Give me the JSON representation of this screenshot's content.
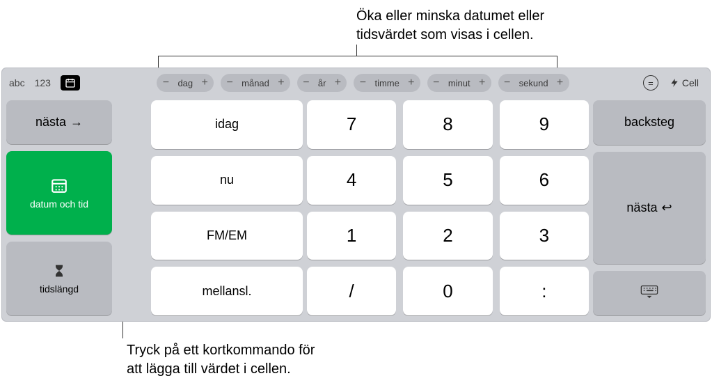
{
  "annotations": {
    "top": "Öka eller minska datumet eller\ntidsvärdet som visas i cellen.",
    "bottom": "Tryck på ett kortkommando för\natt lägga till värdet i cellen."
  },
  "topbar": {
    "tabs": {
      "abc": "abc",
      "num": "123"
    },
    "increments": {
      "day": "dag",
      "month": "månad",
      "year": "år",
      "hour": "timme",
      "minute": "minut",
      "second": "sekund"
    },
    "equals_label": "=",
    "cell_label": "Cell"
  },
  "left": {
    "next": "nästa",
    "datetime": "datum och tid",
    "duration": "tidslängd"
  },
  "shortcuts": {
    "today": "idag",
    "now": "nu",
    "ampm": "FM/EM",
    "space": "mellansl."
  },
  "numpad": {
    "7": "7",
    "8": "8",
    "9": "9",
    "4": "4",
    "5": "5",
    "6": "6",
    "1": "1",
    "2": "2",
    "3": "3",
    "slash": "/",
    "0": "0",
    "colon": ":"
  },
  "right": {
    "backspace": "backsteg",
    "next": "nästa"
  }
}
